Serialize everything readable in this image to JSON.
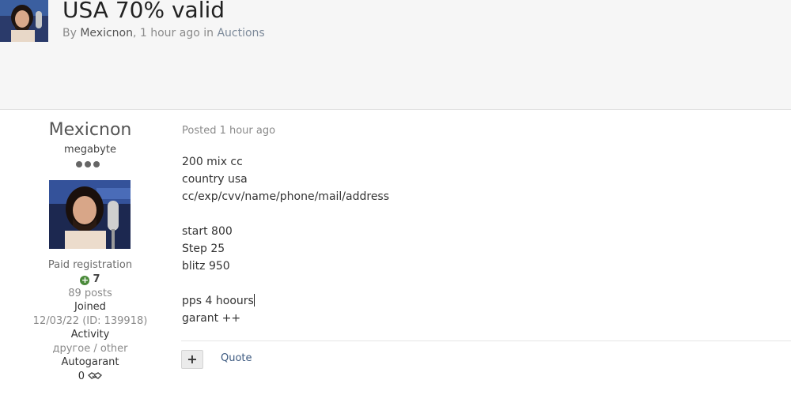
{
  "topic": {
    "title": "USA 70% valid",
    "by_prefix": "By",
    "author": "Mexicnon",
    "time": "1 hour ago",
    "in_word": "in",
    "forum": "Auctions"
  },
  "author_panel": {
    "name": "Mexicnon",
    "rank": "megabyte",
    "group": "Paid registration",
    "reputation": "7",
    "posts": "89 posts",
    "joined_label": "Joined",
    "joined_value": "12/03/22 (ID: 139918)",
    "activity_label": "Activity",
    "activity_value": "другое / other",
    "autogarant_label": "Autogarant",
    "autogarant_value": "0"
  },
  "post": {
    "posted": "Posted 1 hour ago",
    "lines": [
      "200 mix cc",
      "country usa",
      "cc/exp/cvv/name/phone/mail/address",
      "",
      "start 800",
      "Step 25",
      "blitz 950",
      "",
      "pps 4 hoours",
      "garant ++"
    ],
    "plus_label": "+",
    "quote_label": "Quote"
  },
  "icons": {
    "reputation": "plus-circle-icon",
    "autogarant": "handshake-icon"
  }
}
